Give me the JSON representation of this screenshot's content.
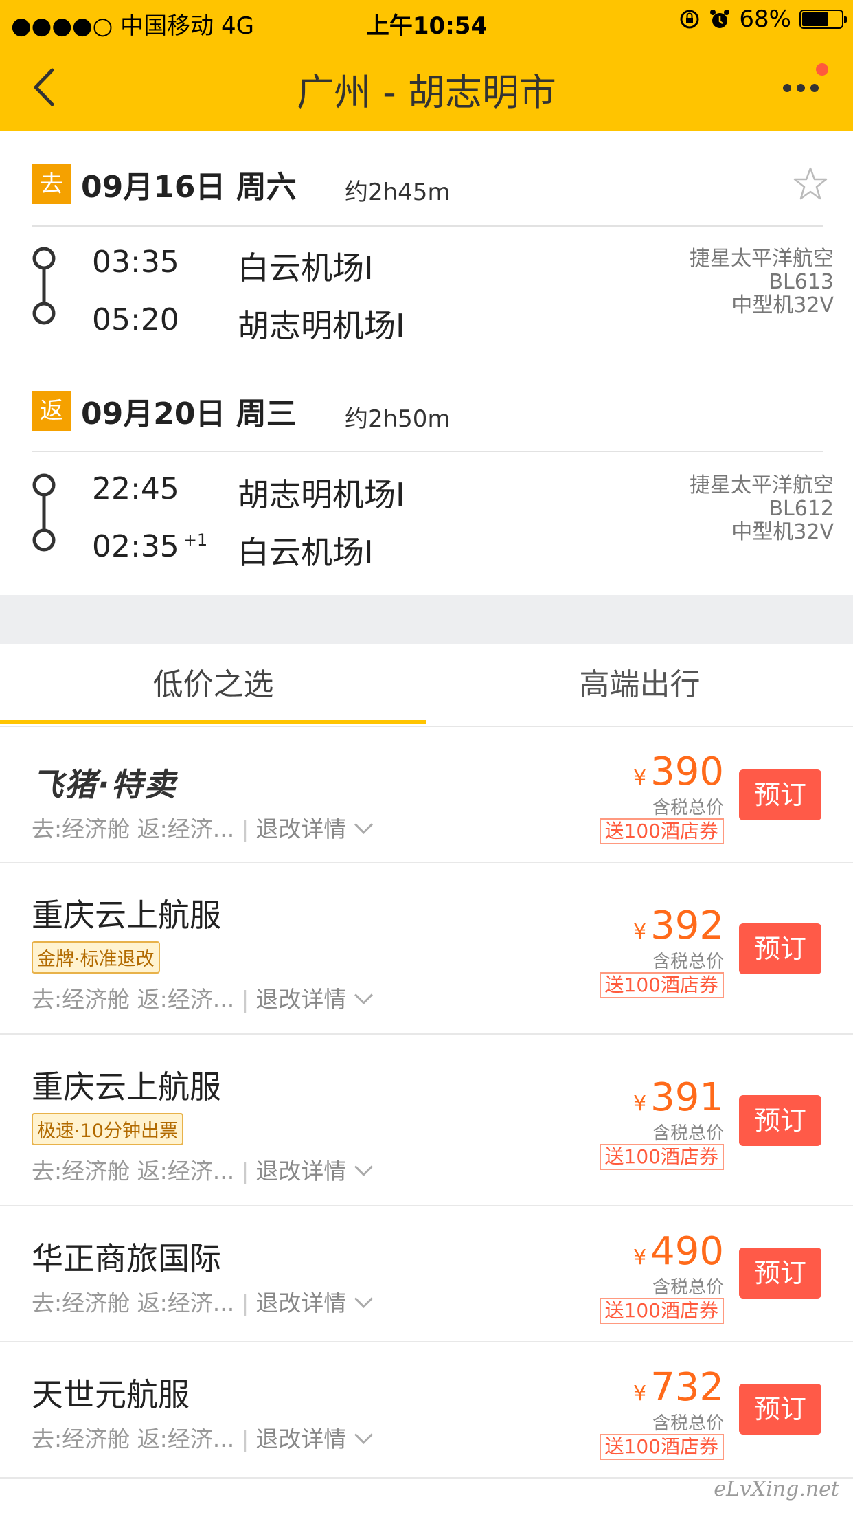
{
  "status_bar": {
    "carrier": "●●●●○ 中国移动  4G",
    "time": "上午10:54",
    "battery": "68%",
    "battery_level": 0.68
  },
  "nav": {
    "title": "广州 - 胡志明市"
  },
  "outbound": {
    "tag": "去",
    "date": "09月16日 周六",
    "duration": "约2h45m",
    "depart_time": "03:35",
    "depart_airport": "白云机场I",
    "arrive_time": "05:20",
    "arrive_airport": "胡志明机场I",
    "airline": "捷星太平洋航空",
    "flight_no": "BL613",
    "aircraft": "中型机32V"
  },
  "return": {
    "tag": "返",
    "date": "09月20日 周三",
    "duration": "约2h50m",
    "depart_time": "22:45",
    "depart_airport": "胡志明机场I",
    "arrive_time": "02:35",
    "arrive_plus": "+1",
    "arrive_airport": "白云机场I",
    "airline": "捷星太平洋航空",
    "flight_no": "BL612",
    "aircraft": "中型机32V"
  },
  "tabs": [
    {
      "label": "低价之选",
      "active": true
    },
    {
      "label": "高端出行",
      "active": false
    }
  ],
  "offers": [
    {
      "vendor": "飞猪·特卖",
      "cabin": "去:经济舱 返:经济...",
      "detail": "退改详情",
      "currency": "¥",
      "price": "390",
      "tax_note": "含税总价",
      "coupon": "送100酒店券",
      "book": "预订"
    },
    {
      "vendor": "重庆云上航服",
      "badge": "金牌·标准退改",
      "cabin": "去:经济舱 返:经济...",
      "detail": "退改详情",
      "currency": "¥",
      "price": "392",
      "tax_note": "含税总价",
      "coupon": "送100酒店券",
      "book": "预订"
    },
    {
      "vendor": "重庆云上航服",
      "badge": "极速·10分钟出票",
      "cabin": "去:经济舱 返:经济...",
      "detail": "退改详情",
      "currency": "¥",
      "price": "391",
      "tax_note": "含税总价",
      "coupon": "送100酒店券",
      "book": "预订"
    },
    {
      "vendor": "华正商旅国际",
      "cabin": "去:经济舱 返:经济...",
      "detail": "退改详情",
      "currency": "¥",
      "price": "490",
      "tax_note": "含税总价",
      "coupon": "送100酒店券",
      "book": "预订"
    },
    {
      "vendor": "天世元航服",
      "cabin": "去:经济舱 返:经济...",
      "detail": "退改详情",
      "currency": "¥",
      "price": "732",
      "tax_note": "含税总价",
      "coupon": "送100酒店券",
      "book": "预订"
    }
  ],
  "watermark": "eLvXing.net",
  "colors": {
    "brand_yellow": "#FFC400",
    "price_orange": "#FF6A1A",
    "book_red": "#FF5A48",
    "tag_orange": "#F5A100"
  }
}
